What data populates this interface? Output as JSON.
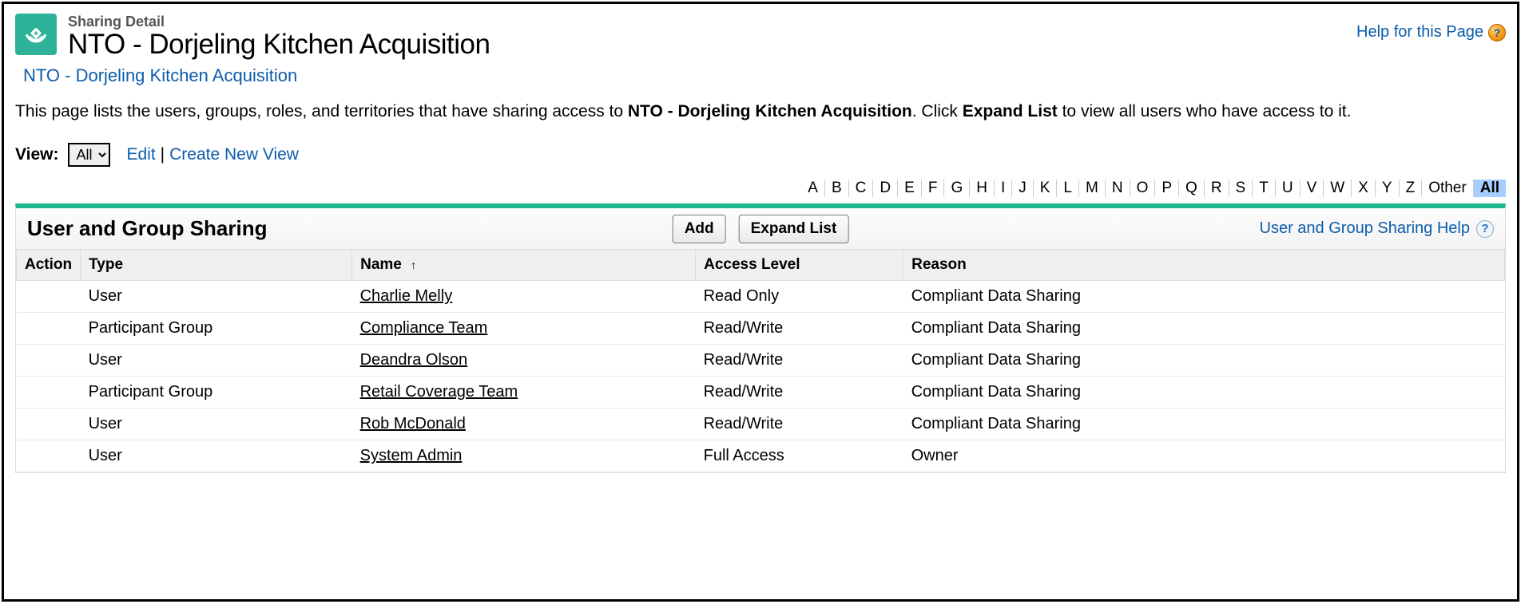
{
  "header": {
    "subtitle": "Sharing Detail",
    "title": "NTO - Dorjeling Kitchen Acquisition",
    "breadcrumb": "NTO - Dorjeling Kitchen Acquisition",
    "help_label": "Help for this Page"
  },
  "description": {
    "pre": "This page lists the users, groups, roles, and territories that have sharing access to ",
    "record_name": "NTO - Dorjeling Kitchen Acquisition",
    "mid": ". Click ",
    "expand": "Expand List",
    "post": " to view all users who have access to it."
  },
  "view": {
    "label": "View:",
    "selected": "All",
    "edit": "Edit",
    "create": "Create New View"
  },
  "alpha": {
    "letters": [
      "A",
      "B",
      "C",
      "D",
      "E",
      "F",
      "G",
      "H",
      "I",
      "J",
      "K",
      "L",
      "M",
      "N",
      "O",
      "P",
      "Q",
      "R",
      "S",
      "T",
      "U",
      "V",
      "W",
      "X",
      "Y",
      "Z"
    ],
    "other": "Other",
    "all": "All"
  },
  "panel": {
    "title": "User and Group Sharing",
    "add_label": "Add",
    "expand_label": "Expand List",
    "help_label": "User and Group Sharing Help"
  },
  "columns": {
    "action": "Action",
    "type": "Type",
    "name": "Name",
    "access": "Access Level",
    "reason": "Reason",
    "sort_indicator": "↑"
  },
  "rows": [
    {
      "type": "User",
      "name": "Charlie Melly",
      "access": "Read Only",
      "reason": "Compliant Data Sharing"
    },
    {
      "type": "Participant Group",
      "name": "Compliance Team",
      "access": "Read/Write",
      "reason": "Compliant Data Sharing"
    },
    {
      "type": "User",
      "name": "Deandra Olson",
      "access": "Read/Write",
      "reason": "Compliant Data Sharing"
    },
    {
      "type": "Participant Group",
      "name": "Retail Coverage Team",
      "access": "Read/Write",
      "reason": "Compliant Data Sharing"
    },
    {
      "type": "User",
      "name": "Rob McDonald",
      "access": "Read/Write",
      "reason": "Compliant Data Sharing"
    },
    {
      "type": "User",
      "name": "System Admin",
      "access": "Full Access",
      "reason": "Owner"
    }
  ]
}
